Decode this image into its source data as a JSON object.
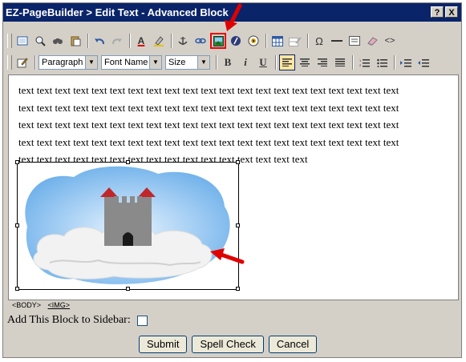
{
  "window": {
    "title": "EZ-PageBuilder > Edit Text - Advanced Block",
    "help_label": "?",
    "close_label": "X"
  },
  "toolbar": {
    "paragraph_format": "Paragraph",
    "font_name": "Font Name",
    "font_size": "Size",
    "bold_label": "B",
    "italic_label": "i",
    "underline_label": "U",
    "text_color_label": "A",
    "special_char_label": "Ω",
    "source_label": "<>"
  },
  "editor": {
    "lines": [
      "text text text text text text text text text text text text text text text text text text text text text",
      "text text text text text text text text text text text text text text text text text text text text text",
      "text text text text text text text text text text text text text text text text text text text text text",
      "text text text text text text text text text text text text text text text text text text text text text",
      "text text text text text text text text text text text text text text text text"
    ]
  },
  "statusbar": {
    "body_tag": "<BODY>",
    "img_tag": "<IMG>"
  },
  "form": {
    "sidebar_label": "Add This Block to Sidebar:",
    "sidebar_checked": false
  },
  "buttons": {
    "submit": "Submit",
    "spell_check": "Spell Check",
    "cancel": "Cancel"
  },
  "colors": {
    "titlebar": "#0a246a",
    "chrome": "#d4d0c8",
    "highlight": "#e00000",
    "sky": "#7ab8ef",
    "castle": "#8a8a8a",
    "roof": "#c0262a"
  }
}
